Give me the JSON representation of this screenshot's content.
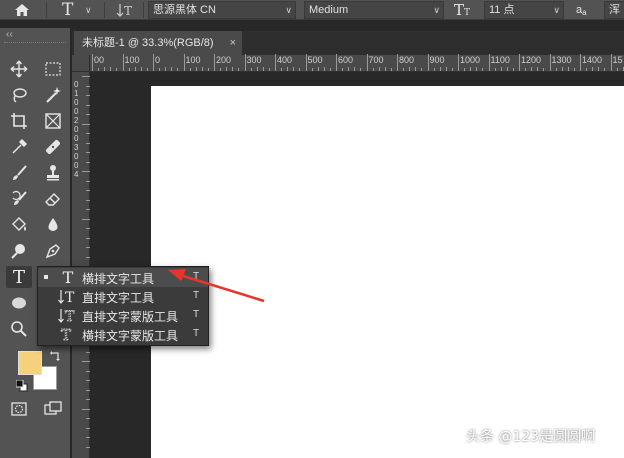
{
  "options_bar": {
    "font_family": "思源黑体 CN",
    "font_style": "Medium",
    "font_size": "11 点",
    "aa_label": "a",
    "aa_label_sub": "a",
    "antialias_value": "浑"
  },
  "document_tab": {
    "title": "未标题-1 @ 33.3%(RGB/8)",
    "close": "×"
  },
  "ruler": {
    "ticks": [
      "00",
      "100",
      "0",
      "100",
      "200",
      "300",
      "400",
      "500",
      "600",
      "700",
      "800",
      "900",
      "1000",
      "1100",
      "1200",
      "1300",
      "1400",
      "15"
    ],
    "vticks": [
      "0",
      "1",
      "0",
      "0",
      "2",
      "0",
      "0",
      "3",
      "0",
      "0",
      "4"
    ]
  },
  "flyout": {
    "items": [
      {
        "label": "横排文字工具",
        "shortcut": "T",
        "selected": true,
        "icon": "horizontal-type-icon"
      },
      {
        "label": "直排文字工具",
        "shortcut": "T",
        "selected": false,
        "icon": "vertical-type-icon"
      },
      {
        "label": "直排文字蒙版工具",
        "shortcut": "T",
        "selected": false,
        "icon": "vertical-type-mask-icon"
      },
      {
        "label": "横排文字蒙版工具",
        "shortcut": "T",
        "selected": false,
        "icon": "horizontal-type-mask-icon"
      }
    ]
  },
  "colors": {
    "foreground": "#f6d17d",
    "background": "#ffffff",
    "annotation_arrow": "#e8352b"
  },
  "watermark": "头条 @123是圆圆啊"
}
